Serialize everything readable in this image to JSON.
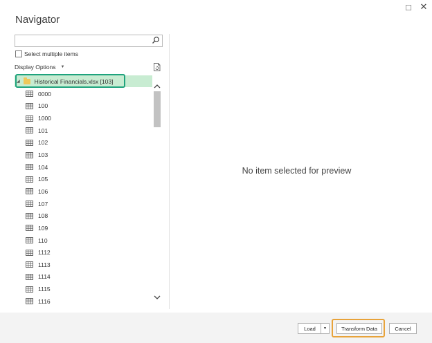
{
  "window": {
    "title": "Navigator",
    "maximize_icon": "□",
    "close_icon": "✕"
  },
  "search": {
    "value": "",
    "placeholder": "",
    "icon": "search-icon"
  },
  "options": {
    "select_multiple_label": "Select multiple items",
    "select_multiple_checked": false,
    "display_options_label": "Display Options"
  },
  "tree": {
    "root": {
      "label": "Historical Financials.xlsx [103]",
      "expanded": true
    },
    "items": [
      {
        "label": "0000"
      },
      {
        "label": "100"
      },
      {
        "label": "1000"
      },
      {
        "label": "101"
      },
      {
        "label": "102"
      },
      {
        "label": "103"
      },
      {
        "label": "104"
      },
      {
        "label": "105"
      },
      {
        "label": "106"
      },
      {
        "label": "107"
      },
      {
        "label": "108"
      },
      {
        "label": "109"
      },
      {
        "label": "110"
      },
      {
        "label": "1112"
      },
      {
        "label": "1113"
      },
      {
        "label": "1114"
      },
      {
        "label": "1115"
      },
      {
        "label": "1116"
      }
    ]
  },
  "preview": {
    "message": "No item selected for preview"
  },
  "footer": {
    "load_label": "Load",
    "transform_label": "Transform Data",
    "cancel_label": "Cancel"
  },
  "colors": {
    "root_highlight_bg": "#c8ecd2",
    "root_outline": "#1fa37d",
    "transform_outline": "#e8a33a",
    "footer_bg": "#f3f3f3"
  }
}
